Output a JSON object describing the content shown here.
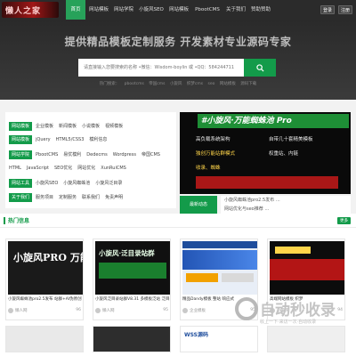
{
  "nav": {
    "logo_text": "懒人之家",
    "items": [
      "首页",
      "网站模板",
      "网站学院",
      "小旋风SEO",
      "网站模板",
      "PbootCMS",
      "关于我们",
      "赞助赞助"
    ],
    "login": "登录",
    "register": "注册"
  },
  "hero": {
    "slogan": "提供精品模板定制服务 开发素材专业源码专家",
    "search_placeholder": "请直接输入您要搜索的名称 •微信：Wisdom-boylin 或 •QQ：584244711",
    "hot_words": [
      "热门搜索：",
      "pbootcms",
      "帝国cms",
      "小旋风",
      "织梦cms",
      "seo",
      "网站模板",
      "源码下载"
    ]
  },
  "categories": [
    {
      "head": "网站模板",
      "links": [
        "企业模板",
        "新闻模板",
        "小说模板",
        "视频模板"
      ]
    },
    {
      "head": "网站模板",
      "links": [
        "jQuery",
        "HTML5/CSS3",
        "模利信息"
      ]
    },
    {
      "head": "网站学院",
      "links": [
        "PbootCMS",
        "易优模利",
        "Dedecms",
        "Wordpress",
        "帝国CMS"
      ]
    },
    {
      "head": "",
      "links": [
        "HTML",
        "JavaScript",
        "SEO优化",
        "网站优化",
        "XunRuiCMS"
      ]
    },
    {
      "head": "网站工具",
      "links": [
        "小旋风SEO",
        "小旋风蜘蛛池",
        "小旋风泛目录"
      ]
    },
    {
      "head": "关于我们",
      "links": [
        "服务项目",
        "定制服务",
        "联系我们",
        "免责声明"
      ]
    }
  ],
  "banner": {
    "title": "#小旋风·万能蜘蛛池 Pro",
    "lines": [
      "高负载系统架构",
      "自带几十套精美模板",
      "独创万能站群模式",
      "权重站、内链",
      "收录、蜘蛛"
    ],
    "badge": "最新动态",
    "news": [
      "小旋风蜘蛛池pro2.5发布 …",
      "网站优化与seo推荐 …"
    ]
  },
  "hot": {
    "title": "热门信息",
    "more": "更多",
    "cards": [
      {
        "title": "小旋风蜘蛛池pro2.5发布 站群+AI伪原创",
        "category": "懒人网",
        "views": "96",
        "thumb_text": "小旋风PRO 万能蜘蛛池"
      },
      {
        "title": "小旋风泛目录站群V8.31 多模板泛站 泛目录",
        "category": "懒人网",
        "views": "95",
        "thumb_text": "小旋风·泛目录站群"
      },
      {
        "title": "精品Dandy模板 整站 响应式",
        "category": "企业模板",
        "views": "95",
        "thumb_text": ""
      },
      {
        "title": "高端网站模板 织梦",
        "category": "小旋风",
        "views": "94",
        "thumb_text": ""
      }
    ],
    "bottom_cards": [
      "",
      "",
      "WSS源码",
      ""
    ]
  },
  "watermark": {
    "big": "自动秒收录",
    "small": "收上一下·来访一次·自动收录"
  }
}
